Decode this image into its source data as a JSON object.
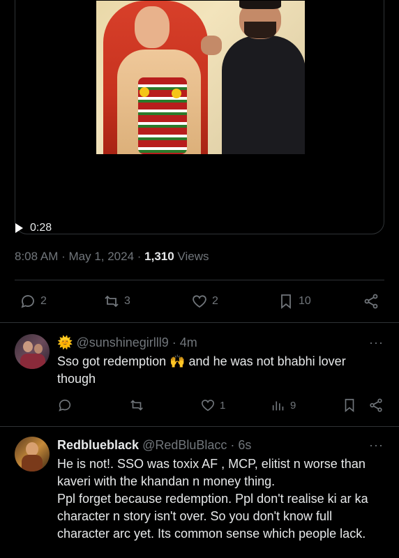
{
  "video": {
    "duration": "0:28"
  },
  "tweet_meta": {
    "time": "8:08 AM",
    "sep1": " · ",
    "date": "May 1, 2024",
    "sep2": " · ",
    "views_count": "1,310",
    "views_label": " Views"
  },
  "actions": {
    "replies": "2",
    "retweets": "3",
    "likes": "2",
    "bookmarks": "10"
  },
  "replies": [
    {
      "emoji": "🌞",
      "handle": "@sunshinegirlll9",
      "sep": " · ",
      "age": "4m",
      "more": "···",
      "text_before": "Sso got redemption ",
      "text_emoji": "🙌",
      "text_after": " and he was not bhabhi lover though",
      "like_count": "1",
      "views_count": "9"
    },
    {
      "name": "Redblueblack",
      "handle": "@RedBluBlacc",
      "sep": " · ",
      "age": "6s",
      "more": "···",
      "lines": [
        "He is not!. SSO was toxix AF , MCP, elitist n worse than kaveri with the khandan n money thing.",
        "Ppl forget because redemption. Ppl don't realise ki ar ka character n story isn't over. So you don't know full character arc yet. Its common sense which people lack."
      ]
    }
  ],
  "colors": {
    "background": "#000000",
    "text": "#e7e9ea",
    "muted": "#71767b",
    "border": "#2f3336"
  }
}
